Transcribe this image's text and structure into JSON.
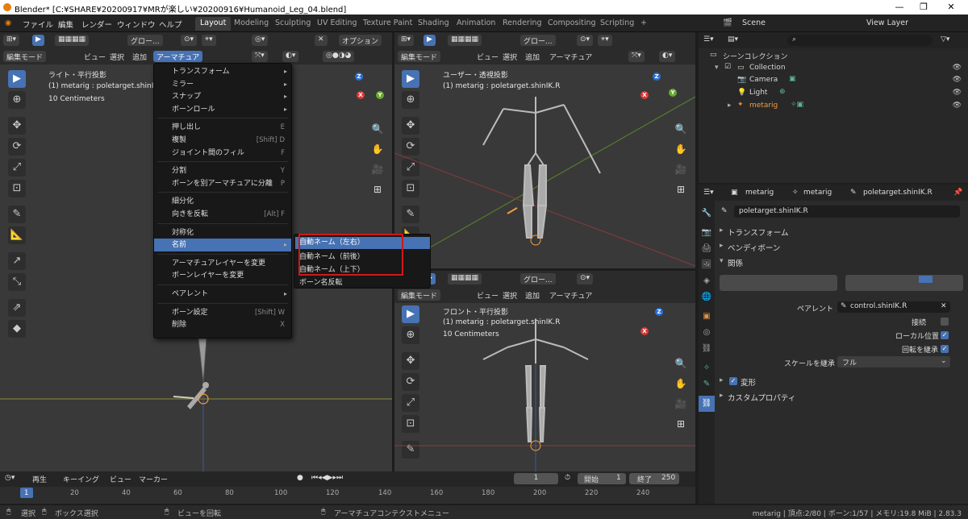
{
  "title": "Blender* [C:¥SHARE¥20200917¥MRが楽しい¥20200916¥Humanoid_Leg_04.blend]",
  "menus": [
    "ファイル",
    "編集",
    "レンダー",
    "ウィンドウ",
    "ヘルプ"
  ],
  "workspaces": [
    "Layout",
    "Modeling",
    "Sculpting",
    "UV Editing",
    "Texture Paint",
    "Shading",
    "Animation",
    "Rendering",
    "Compositing",
    "Scripting"
  ],
  "scene": "Scene",
  "view_layer": "View Layer",
  "left_view": {
    "header": {
      "transform": "グロー...",
      "options": "オプション",
      "mode": "編集モード",
      "view": "ビュー",
      "select": "選択",
      "add": "追加",
      "armature": "アーマチュア"
    },
    "overlay": {
      "view_name": "ライト・平行投影",
      "object": "(1) metarig : poletarget.shinIK.R",
      "scale": "10 Centimeters"
    }
  },
  "context_menu": {
    "items": [
      {
        "label": "トランスフォーム",
        "submenu": true
      },
      {
        "label": "ミラー",
        "submenu": true
      },
      {
        "label": "スナップ",
        "submenu": true
      },
      {
        "label": "ボーンロール",
        "submenu": true
      },
      {
        "label": "押し出し",
        "shortcut": "E"
      },
      {
        "label": "複製",
        "shortcut": "[Shift] D"
      },
      {
        "label": "ジョイント間のフィル",
        "shortcut": "F"
      },
      {
        "label": "分割",
        "shortcut": "Y"
      },
      {
        "label": "ボーンを別アーマチュアに分離",
        "shortcut": "P"
      },
      {
        "label": "細分化"
      },
      {
        "label": "向きを反転",
        "shortcut": "[Alt] F"
      },
      {
        "label": "対称化"
      },
      {
        "label": "名前",
        "submenu": true,
        "highlighted": true
      },
      {
        "label": "アーマチュアレイヤーを変更"
      },
      {
        "label": "ボーンレイヤーを変更"
      },
      {
        "label": "ペアレント",
        "submenu": true
      },
      {
        "label": "ボーン設定",
        "shortcut": "[Shift] W"
      },
      {
        "label": "削除",
        "shortcut": "X"
      }
    ]
  },
  "submenu": {
    "items": [
      "自動ネーム（左右）",
      "自動ネーム（前後）",
      "自動ネーム（上下）",
      "ボーン名反転"
    ]
  },
  "right_top_view": {
    "header": {
      "transform": "グロー...",
      "mode": "編集モード",
      "view": "ビュー",
      "select": "選択",
      "add": "追加",
      "armature": "アーマチュア"
    },
    "overlay": {
      "view_name": "ユーザー・透視投影",
      "object": "(1) metarig : poletarget.shinIK.R"
    }
  },
  "right_bottom_view": {
    "header": {
      "transform": "グロー...",
      "mode": "編集モード",
      "view": "ビュー",
      "select": "選択",
      "add": "追加",
      "armature": "アーマチュア"
    },
    "overlay": {
      "view_name": "フロント・平行投影",
      "object": "(1) metarig : poletarget.shinIK.R",
      "scale": "10 Centimeters"
    }
  },
  "outliner": {
    "title": "シーンコレクション",
    "items": [
      "Collection",
      "Camera",
      "Light",
      "metarig"
    ]
  },
  "properties": {
    "breadcrumb": [
      "metarig",
      "metarig",
      "poletarget.shinIK.R"
    ],
    "bone_name": "poletarget.shinIK.R",
    "sections": [
      "トランスフォーム",
      "ベンディボーン",
      "関係",
      "変形",
      "カスタムプロパティ"
    ],
    "parent_label": "ペアレント",
    "parent_value": "control.shinIK.R",
    "connect_label": "接続",
    "local_location_label": "ローカル位置",
    "inherit_rotation_label": "回転を継承",
    "inherit_scale_label": "スケールを継承",
    "inherit_scale_value": "フル"
  },
  "timeline": {
    "playback": "再生",
    "keying": "キーイング",
    "view": "ビュー",
    "marker": "マーカー",
    "current_frame": "1",
    "start_label": "開始",
    "start": "1",
    "end_label": "終了",
    "end": "250",
    "ticks": [
      "1",
      "20",
      "40",
      "60",
      "80",
      "100",
      "120",
      "140",
      "160",
      "180",
      "200",
      "220",
      "240"
    ]
  },
  "status": {
    "select": "選択",
    "box_select": "ボックス選択",
    "rotate_view": "ビューを回転",
    "context_menu": "アーマチュアコンテクストメニュー",
    "stats": "metarig | 頂点:2/80 | ボーン:1/57 | メモリ:19.8 MiB | 2.83.3"
  }
}
